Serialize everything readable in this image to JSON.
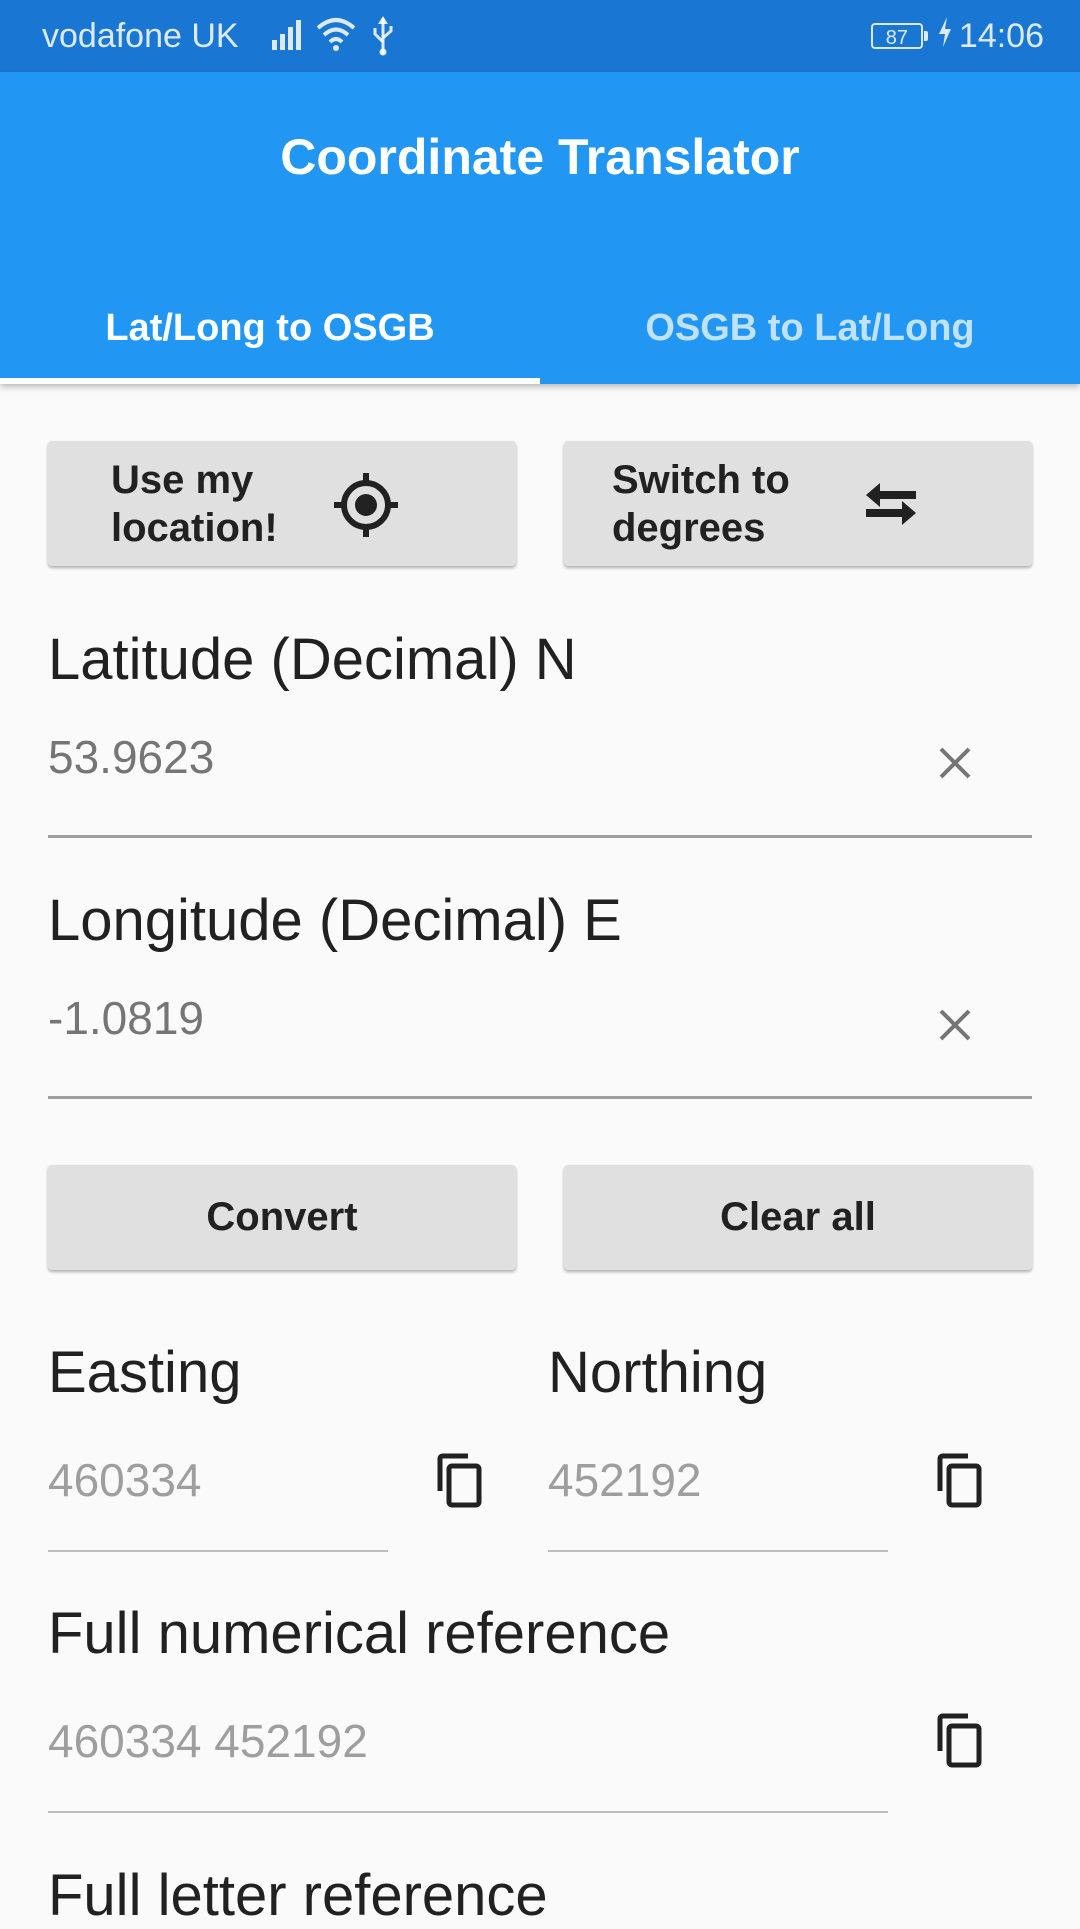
{
  "status_bar": {
    "carrier": "vodafone UK",
    "battery": "87",
    "time": "14:06"
  },
  "app_bar": {
    "title": "Coordinate Translator",
    "tabs": [
      {
        "label": "Lat/Long to OSGB",
        "active": true
      },
      {
        "label": "OSGB to Lat/Long",
        "active": false
      }
    ]
  },
  "actions": {
    "location_line1": "Use my",
    "location_line2": "location!",
    "location_icon": "my-location-icon",
    "switch_line1": "Switch to",
    "switch_line2": "degrees",
    "switch_icon": "swap-horiz-icon"
  },
  "inputs": {
    "latitude_label": "Latitude (Decimal) N",
    "latitude_value": "53.9623",
    "longitude_label": "Longitude (Decimal) E",
    "longitude_value": "-1.0819"
  },
  "buttons": {
    "convert": "Convert",
    "clear_all": "Clear all"
  },
  "outputs": {
    "easting_label": "Easting",
    "easting_value": "460334",
    "northing_label": "Northing",
    "northing_value": "452192",
    "full_numerical_label": "Full numerical reference",
    "full_numerical_value": "460334 452192",
    "full_letter_label": "Full letter reference"
  },
  "colors": {
    "status_bar": "#1976d2",
    "primary": "#2196f3",
    "button": "#e0e0e0",
    "background": "#fafafa"
  }
}
